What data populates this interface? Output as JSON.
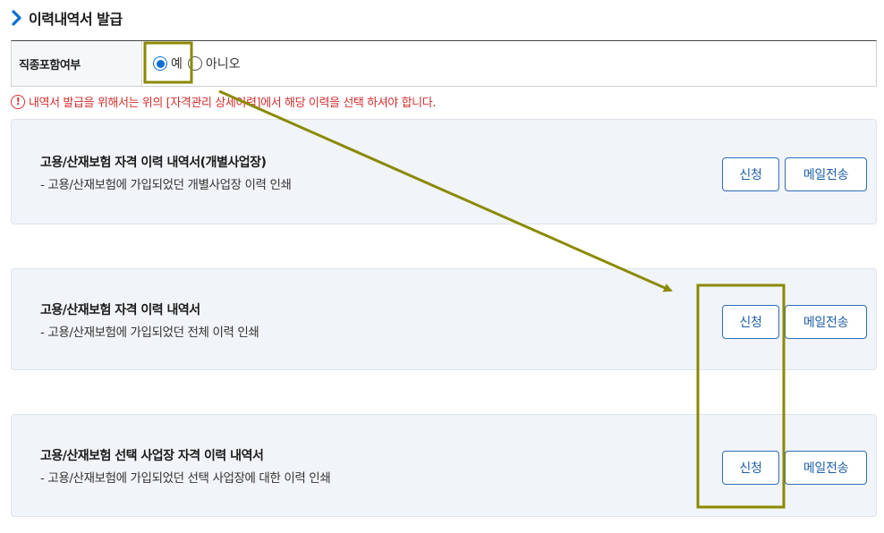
{
  "section": {
    "title": "이력내역서 발급"
  },
  "option": {
    "label": "직종포함여부",
    "choices": [
      {
        "label": "예",
        "checked": true
      },
      {
        "label": "아니오",
        "checked": false
      }
    ]
  },
  "notice": {
    "text": "내역서 발급을 위해서는 위의 [자격관리 상세이력]에서 해당 이력을 선택 하셔야 합니다."
  },
  "cards": [
    {
      "title": "고용/산재보험 자격 이력 내역서(개별사업장)",
      "desc": "- 고용/산재보험에 가입되었던 개별사업장 이력 인쇄",
      "apply_label": "신청",
      "mail_label": "메일전송"
    },
    {
      "title": "고용/산재보험 자격 이력 내역서",
      "desc": "- 고용/산재보험에 가입되었던 전체 이력 인쇄",
      "apply_label": "신청",
      "mail_label": "메일전송"
    },
    {
      "title": "고용/산재보험 선택 사업장 자격 이력 내역서",
      "desc": "- 고용/산재보험에 가입되었던 선택 사업장에 대한 이력 인쇄",
      "apply_label": "신청",
      "mail_label": "메일전송"
    }
  ],
  "colors": {
    "accent": "#1e5ea8",
    "annotation": "#8a8a00",
    "notice": "#d32f2f"
  }
}
